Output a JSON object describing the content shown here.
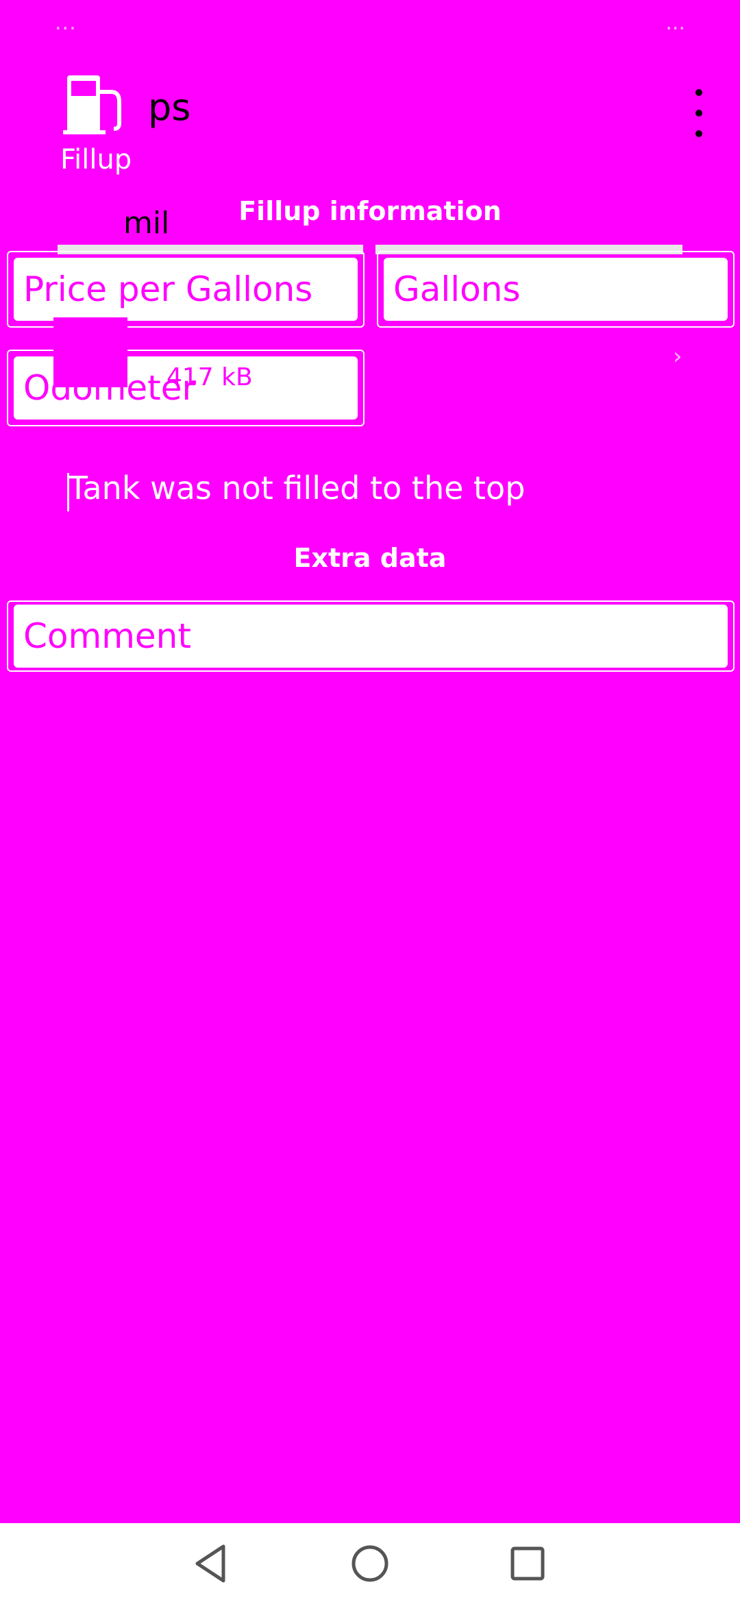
{
  "status_bar": {
    "left_text": "...",
    "right_text": "..."
  },
  "app_bar": {
    "title": "ps",
    "fillup_label": "Fillup",
    "overflow_icon": "more-vert-icon",
    "fuel_icon": "fuel-pump-icon"
  },
  "ghost": {
    "mil_text": "mil",
    "size_text": "417 kB"
  },
  "sections": {
    "fillup_info": "Fillup information",
    "extra_data": "Extra data"
  },
  "fields": {
    "price_per_gallons": "Price per Gallons",
    "gallons": "Gallons",
    "odometer": "Odometer",
    "comment": "Comment"
  },
  "checkbox": {
    "label": "Tank was not filled to the top",
    "checked": false
  },
  "nav": {
    "back": "back-icon",
    "home": "home-icon",
    "recents": "recents-icon"
  }
}
